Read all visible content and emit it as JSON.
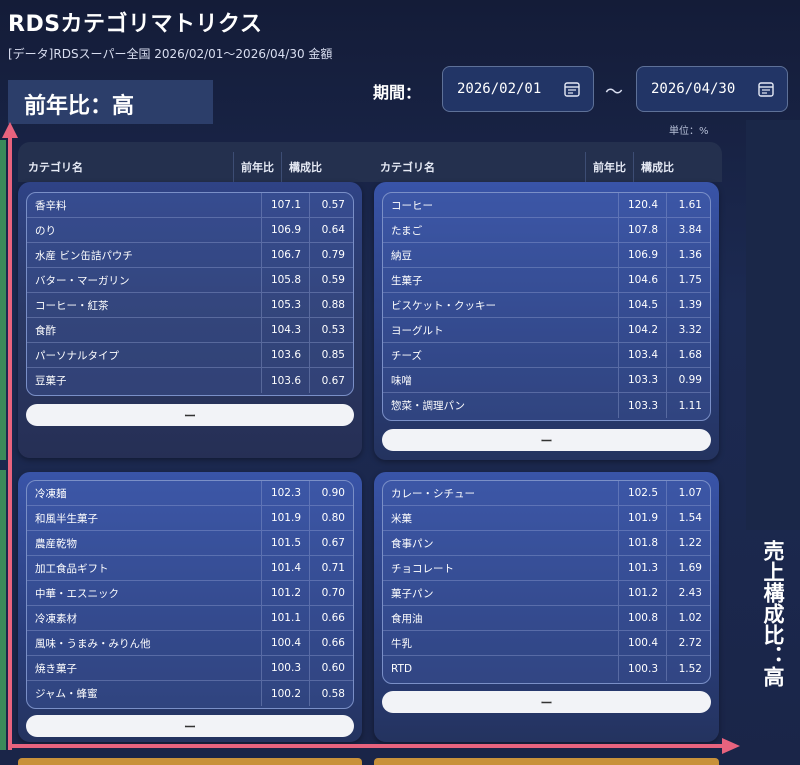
{
  "title": "RDSカテゴリマトリクス",
  "subtitle": "[データ]RDSスーパー全国 2026/02/01～2026/04/30 金額",
  "y_axis_label": "前年比：高",
  "x_axis_label": "売上構成比：高",
  "period": {
    "label": "期間：",
    "start": "2026/02/01",
    "separator": "～",
    "end": "2026/04/30"
  },
  "unit": "単位：%",
  "columns": {
    "name": "カテゴリ名",
    "yoy": "前年比",
    "share": "構成比"
  },
  "collapse_label": "ー",
  "quadrants": {
    "top_left": [
      {
        "name": "香辛料",
        "yoy": "107.1",
        "share": "0.57"
      },
      {
        "name": "のり",
        "yoy": "106.9",
        "share": "0.64"
      },
      {
        "name": "水産 ビン缶詰パウチ",
        "yoy": "106.7",
        "share": "0.79"
      },
      {
        "name": "バター・マーガリン",
        "yoy": "105.8",
        "share": "0.59"
      },
      {
        "name": "コーヒー・紅茶",
        "yoy": "105.3",
        "share": "0.88"
      },
      {
        "name": "食酢",
        "yoy": "104.3",
        "share": "0.53"
      },
      {
        "name": "パーソナルタイプ",
        "yoy": "103.6",
        "share": "0.85"
      },
      {
        "name": "豆菓子",
        "yoy": "103.6",
        "share": "0.67"
      }
    ],
    "top_right": [
      {
        "name": "コーヒー",
        "yoy": "120.4",
        "share": "1.61"
      },
      {
        "name": "たまご",
        "yoy": "107.8",
        "share": "3.84"
      },
      {
        "name": "納豆",
        "yoy": "106.9",
        "share": "1.36"
      },
      {
        "name": "生菓子",
        "yoy": "104.6",
        "share": "1.75"
      },
      {
        "name": "ビスケット・クッキー",
        "yoy": "104.5",
        "share": "1.39"
      },
      {
        "name": "ヨーグルト",
        "yoy": "104.2",
        "share": "3.32"
      },
      {
        "name": "チーズ",
        "yoy": "103.4",
        "share": "1.68"
      },
      {
        "name": "味噌",
        "yoy": "103.3",
        "share": "0.99"
      },
      {
        "name": "惣菜・調理パン",
        "yoy": "103.3",
        "share": "1.11"
      }
    ],
    "bottom_left": [
      {
        "name": "冷凍麺",
        "yoy": "102.3",
        "share": "0.90"
      },
      {
        "name": "和風半生菓子",
        "yoy": "101.9",
        "share": "0.80"
      },
      {
        "name": "農産乾物",
        "yoy": "101.5",
        "share": "0.67"
      },
      {
        "name": "加工食品ギフト",
        "yoy": "101.4",
        "share": "0.71"
      },
      {
        "name": "中華・エスニック",
        "yoy": "101.2",
        "share": "0.70"
      },
      {
        "name": "冷凍素材",
        "yoy": "101.1",
        "share": "0.66"
      },
      {
        "name": "風味・うまみ・みりん他",
        "yoy": "100.4",
        "share": "0.66"
      },
      {
        "name": "焼き菓子",
        "yoy": "100.3",
        "share": "0.60"
      },
      {
        "name": "ジャム・蜂蜜",
        "yoy": "100.2",
        "share": "0.58"
      }
    ],
    "bottom_right": [
      {
        "name": "カレー・シチュー",
        "yoy": "102.5",
        "share": "1.07"
      },
      {
        "name": "米菓",
        "yoy": "101.9",
        "share": "1.54"
      },
      {
        "name": "食事パン",
        "yoy": "101.8",
        "share": "1.22"
      },
      {
        "name": "チョコレート",
        "yoy": "101.3",
        "share": "1.69"
      },
      {
        "name": "菓子パン",
        "yoy": "101.2",
        "share": "2.43"
      },
      {
        "name": "食用油",
        "yoy": "100.8",
        "share": "1.02"
      },
      {
        "name": "牛乳",
        "yoy": "100.4",
        "share": "2.72"
      },
      {
        "name": "RTD",
        "yoy": "100.3",
        "share": "1.52"
      }
    ]
  },
  "colors": {
    "axis": "#e8637e",
    "accent": "#3954a8",
    "bottom_tab": "#c8913a"
  }
}
